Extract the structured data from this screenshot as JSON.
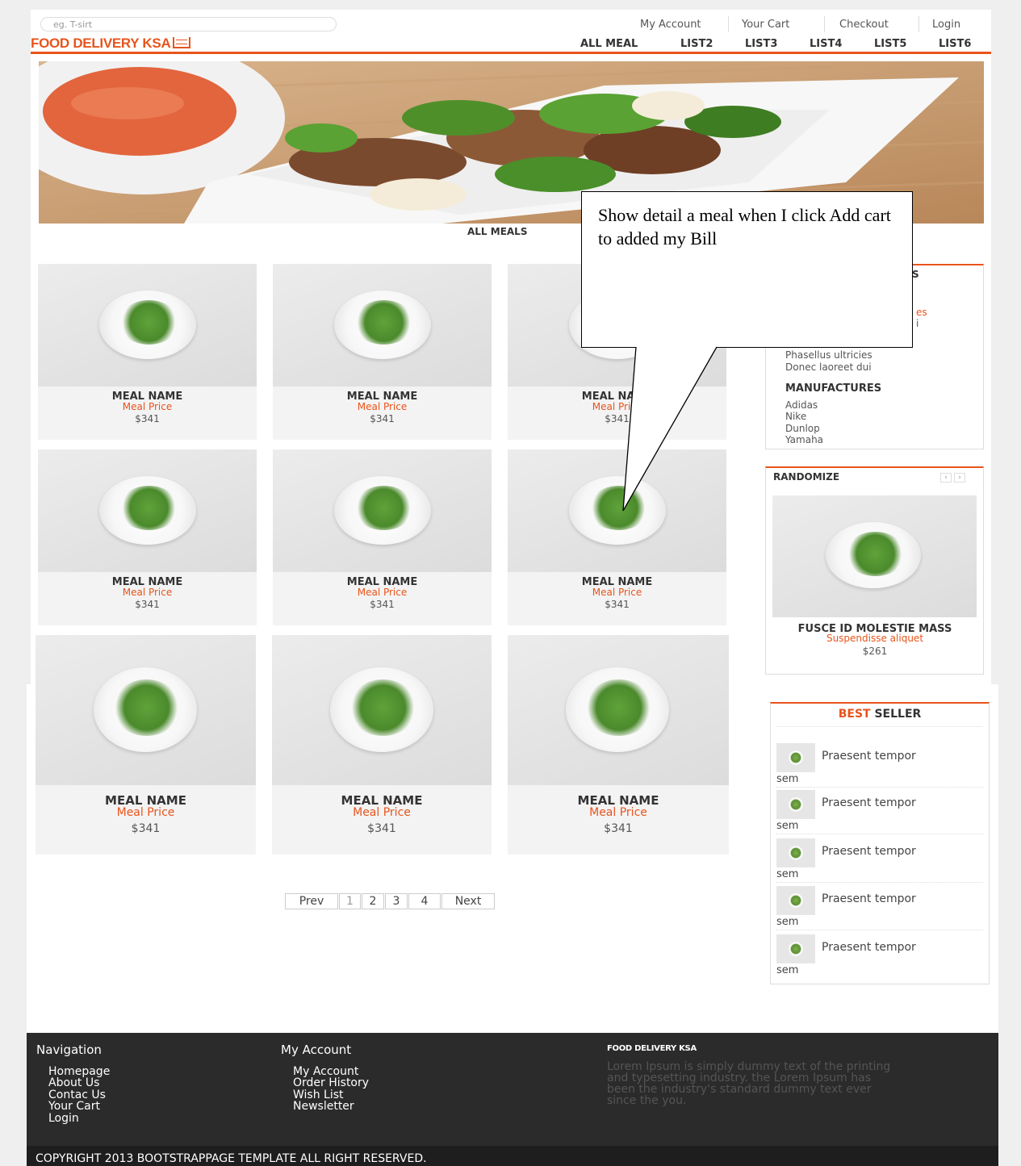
{
  "header": {
    "search_placeholder": "eg. T-sirt",
    "top_links": [
      "My Account",
      "Your Cart",
      "Checkout",
      "Login"
    ],
    "logo": "FOOD DELIVERY KSA",
    "nav": [
      "ALL MEAL",
      "LIST2",
      "LIST3",
      "LIST4",
      "LIST5",
      "LIST6"
    ]
  },
  "main": {
    "section_title": "ALL MEALS",
    "meals": [
      {
        "name": "MEAL NAME",
        "price_label": "Meal Price",
        "price": "$341"
      },
      {
        "name": "MEAL NAME",
        "price_label": "Meal Price",
        "price": "$341"
      },
      {
        "name": "MEAL NAME",
        "price_label": "Meal Price",
        "price": "$341"
      },
      {
        "name": "MEAL NAME",
        "price_label": "Meal Price",
        "price": "$341"
      },
      {
        "name": "MEAL NAME",
        "price_label": "Meal Price",
        "price": "$341"
      },
      {
        "name": "MEAL NAME",
        "price_label": "Meal Price",
        "price": "$341"
      },
      {
        "name": "MEAL NAME",
        "price_label": "Meal Price",
        "price": "$341"
      },
      {
        "name": "MEAL NAME",
        "price_label": "Meal Price",
        "price": "$341"
      },
      {
        "name": "MEAL NAME",
        "price_label": "Meal Price",
        "price": "$341"
      }
    ],
    "pagination": [
      "Prev",
      "1",
      "2",
      "3",
      "4",
      "Next"
    ]
  },
  "callout": {
    "text": "Show detail a meal when I click Add cart to added my Bill"
  },
  "sidebar": {
    "categories": {
      "title_fragment": "S",
      "items_visible": [
        {
          "text": "es",
          "highlight": true
        },
        {
          "text": "i",
          "highlight": false
        },
        {
          "text": "Phasellus ultricies",
          "highlight": false
        },
        {
          "text": "Donec laoreet dui",
          "highlight": false
        }
      ]
    },
    "manufactures": {
      "title": "MANUFACTURES",
      "items": [
        "Adidas",
        "Nike",
        "Dunlop",
        "Yamaha"
      ]
    },
    "randomize": {
      "title": "RANDOMIZE",
      "prev": "‹",
      "next": "›",
      "product_name": "FUSCE ID MOLESTIE MASS",
      "product_subtitle": "Suspendisse aliquet",
      "product_price": "$261"
    },
    "best_seller": {
      "title_accent": "BEST",
      "title_rest": "SELLER",
      "items": [
        {
          "line1": "Praesent tempor",
          "line2": "sem"
        },
        {
          "line1": "Praesent tempor",
          "line2": "sem"
        },
        {
          "line1": "Praesent tempor",
          "line2": "sem"
        },
        {
          "line1": "Praesent tempor",
          "line2": "sem"
        },
        {
          "line1": "Praesent tempor",
          "line2": "sem"
        }
      ]
    }
  },
  "footer": {
    "nav_title": "Navigation",
    "nav_links": [
      "Homepage",
      "About Us",
      "Contac Us",
      "Your Cart",
      "Login"
    ],
    "account_title": "My Account",
    "account_links": [
      "My Account",
      "Order History",
      "Wish List",
      "Newsletter"
    ],
    "brand": "FOOD DELIVERY KSA",
    "about_lines": [
      "Lorem Ipsum is simply dummy text of the printing",
      "and typesetting industry. the Lorem Ipsum has",
      "been the industry's standard dummy text ever",
      "since the you."
    ],
    "copyright": "COPYRIGHT 2013 BOOTSTRAPPAGE TEMPLATE ALL RIGHT RESERVED."
  },
  "colors": {
    "accent": "#e8541c",
    "footer_bg": "#2b2b2b",
    "copyright_bg": "#1e1e1e"
  }
}
